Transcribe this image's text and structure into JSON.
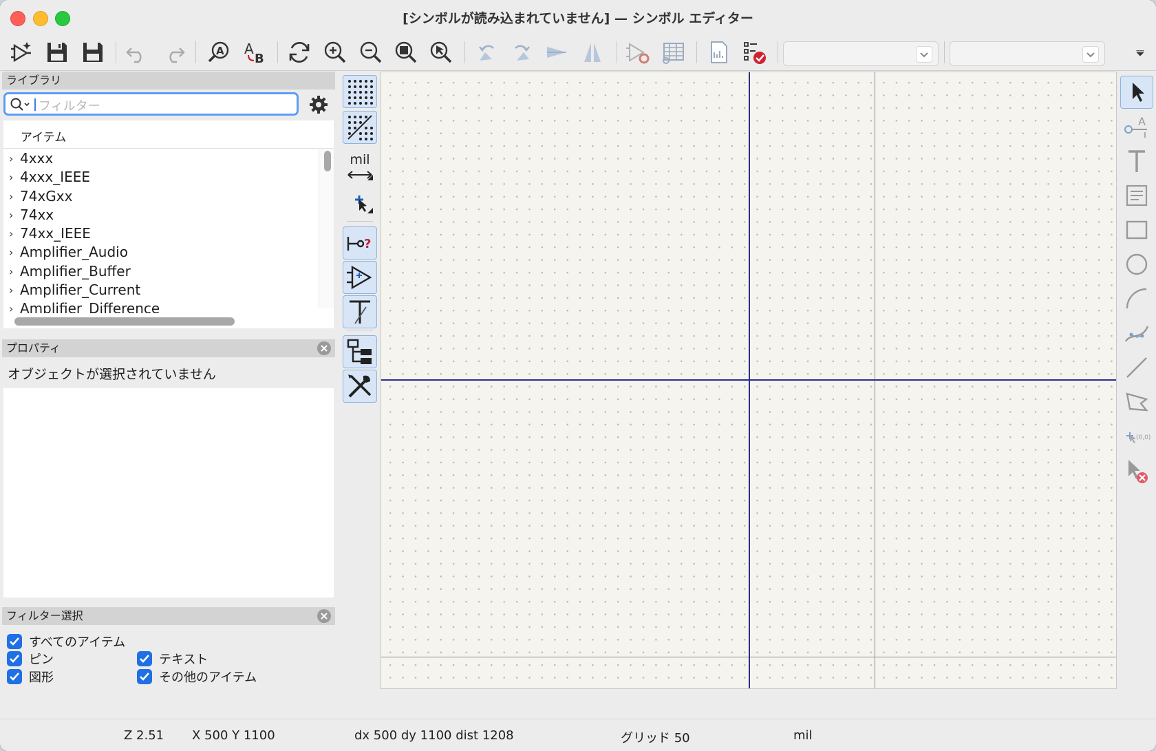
{
  "window": {
    "title": "[シンボルが読み込まれていません] — シンボル エディター"
  },
  "toolbar": {
    "buttons": [
      "new-symbol-icon",
      "save-icon",
      "save-all-icon",
      "undo-icon",
      "redo-icon",
      "find-icon",
      "find-replace-icon",
      "refresh-icon",
      "zoom-in-icon",
      "zoom-out-icon",
      "zoom-fit-icon",
      "zoom-selection-icon",
      "rotate-ccw-icon",
      "rotate-cw-icon",
      "mirror-h-icon",
      "mirror-v-icon",
      "symbol-properties-icon",
      "pin-table-icon",
      "datasheet-icon",
      "erc-check-icon"
    ],
    "unit_combo_value": "",
    "part_combo_value": ""
  },
  "library_panel": {
    "title": "ライブラリ",
    "search_placeholder": "フィルター",
    "column_header": "アイテム",
    "items": [
      "4xxx",
      "4xxx_IEEE",
      "74xGxx",
      "74xx",
      "74xx_IEEE",
      "Amplifier_Audio",
      "Amplifier_Buffer",
      "Amplifier_Current",
      "Amplifier_Difference"
    ]
  },
  "properties_panel": {
    "title": "プロパティ",
    "message": "オブジェクトが選択されていません"
  },
  "filter_panel": {
    "title": "フィルター選択",
    "options": [
      {
        "label": "すべてのアイテム",
        "checked": true
      },
      {
        "label": "ピン",
        "checked": true
      },
      {
        "label": "テキスト",
        "checked": true
      },
      {
        "label": "図形",
        "checked": true
      },
      {
        "label": "その他のアイテム",
        "checked": true
      }
    ]
  },
  "left_toolbar": {
    "units_label": "mil"
  },
  "status_bar": {
    "zoom": "Z 2.51",
    "position": "X 500  Y 1100",
    "delta": "dx 500  dy 1100  dist 1208",
    "grid": "グリッド 50",
    "units": "mil"
  },
  "colors": {
    "accent": "#1f6fe5",
    "axis": "#2a2e8c",
    "canvas_bg": "#f5f4ef",
    "erc_red": "#d0222e"
  }
}
